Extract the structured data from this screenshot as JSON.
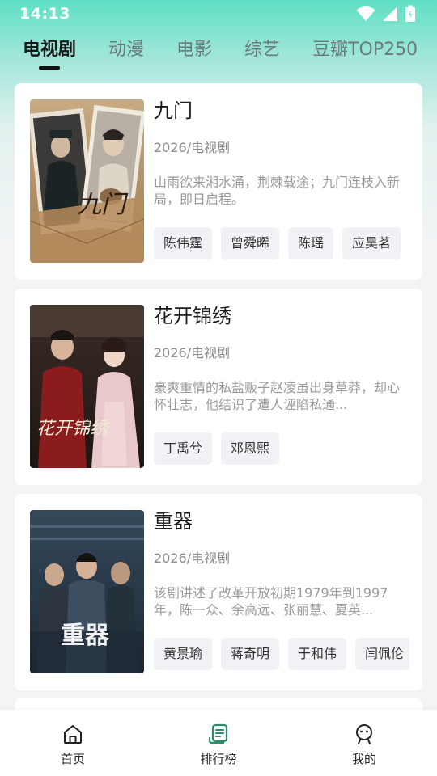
{
  "status_bar": {
    "time": "14:13"
  },
  "tabs": [
    {
      "label": "电视剧",
      "active": true
    },
    {
      "label": "动漫",
      "active": false
    },
    {
      "label": "电影",
      "active": false
    },
    {
      "label": "综艺",
      "active": false
    },
    {
      "label": "豆瓣TOP250",
      "active": false
    }
  ],
  "shows": [
    {
      "title": "九门",
      "meta": "2026/电视剧",
      "description": "山雨欲来湘水涌，荆棘载途；九门连枝入新局，即日启程。",
      "cast": [
        "陈伟霆",
        "曾舜晞",
        "陈瑶",
        "应昊茗"
      ]
    },
    {
      "title": "花开锦绣",
      "meta": "2026/电视剧",
      "description": "豪爽重情的私盐贩子赵凌虽出身草莽，却心怀壮志，他结识了遭人诬陷私通...",
      "cast": [
        "丁禹兮",
        "邓恩熙"
      ]
    },
    {
      "title": "重器",
      "meta": "2026/电视剧",
      "description": "该剧讲述了改革开放初期1979年到1997年，陈一众、余高远、张丽慧、夏英...",
      "cast": [
        "黄景瑜",
        "蒋奇明",
        "于和伟",
        "闫佩伦"
      ]
    }
  ],
  "posters": {
    "poster1_text": "九门",
    "poster2_text": "花开锦绣",
    "poster3_text": "重器"
  },
  "bottom_nav": [
    {
      "label": "首页",
      "icon": "home-icon"
    },
    {
      "label": "排行榜",
      "icon": "ranking-icon"
    },
    {
      "label": "我的",
      "icon": "profile-icon"
    }
  ],
  "colors": {
    "accent": "#5fe0c4",
    "ranking_icon": "#2e8b6f"
  }
}
